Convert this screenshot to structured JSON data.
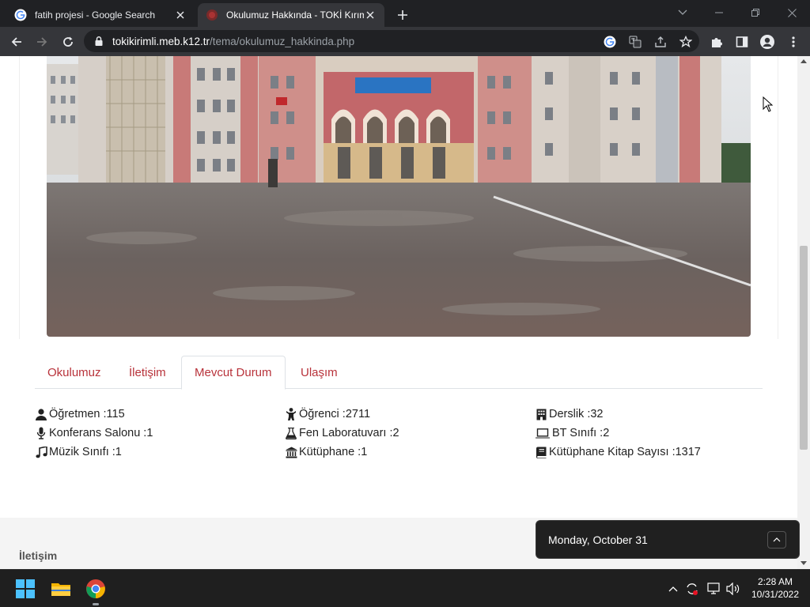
{
  "browser": {
    "tabs": [
      {
        "title": "fatih projesi - Google Search",
        "active": false
      },
      {
        "title": "Okulumuz Hakkında - TOKİ Kırımlı",
        "active": true
      }
    ],
    "url": {
      "host": "tokikirimli.meb.k12.tr",
      "path": "/tema/okulumuz_hakkinda.php"
    }
  },
  "page": {
    "tabs": [
      "Okulumuz",
      "İletişim",
      "Mevcut Durum",
      "Ulaşım"
    ],
    "active_tab": "Mevcut Durum",
    "stats": {
      "teachers": "Öğretmen :115",
      "students": "Öğrenci :2711",
      "classrooms": "Derslik :32",
      "conference": "Konferans Salonu :1",
      "science_lab": "Fen Laboratuvarı :2",
      "it_room": "BT Sınıfı :2",
      "music_room": "Müzik Sınıfı :1",
      "library": "Kütüphane :1",
      "library_books": "Kütüphane Kitap Sayısı :1317"
    },
    "footer_title": "İletişim"
  },
  "toast": {
    "date": "Monday, October 31"
  },
  "taskbar": {
    "time": "2:28 AM",
    "date": "10/31/2022"
  },
  "colors": {
    "accent": "#b8323a",
    "tabstrip": "#202124",
    "toolbar": "#35363a"
  }
}
